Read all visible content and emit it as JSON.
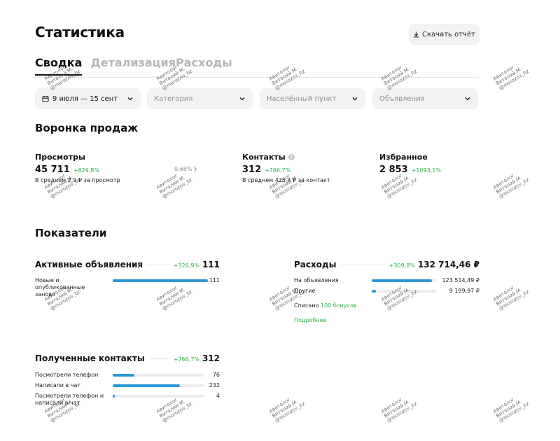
{
  "header": {
    "title": "Статистика",
    "download_label": "Скачать отчёт"
  },
  "tabs": [
    {
      "label": "Сводка",
      "active": true
    },
    {
      "label": "Детализация",
      "active": false
    },
    {
      "label": "Расходы",
      "active": false
    }
  ],
  "filters": {
    "period": "9 июля — 15 сент",
    "category_placeholder": "Категория",
    "city_placeholder": "Населённый пункт",
    "ads_placeholder": "Объявления"
  },
  "funnel": {
    "title": "Воронка продаж",
    "views": {
      "label": "Просмотры",
      "value": "45 711",
      "change": "+629,8%",
      "sub": "В среднем 2,9 ₽ за просмотр"
    },
    "conversion": "0,68%",
    "contacts": {
      "label": "Контакты",
      "value": "312",
      "change": "+766,7%",
      "sub": "В среднем 425,4 ₽ за контакт"
    },
    "favorites": {
      "label": "Избранное",
      "value": "2 853",
      "change": "+1093,1%"
    }
  },
  "indicators": {
    "title": "Показатели",
    "active_ads": {
      "title": "Активные объявления",
      "change": "+326,9%",
      "total": "111",
      "rows": [
        {
          "label": "Новые и опубликованные заново",
          "value": "111",
          "fraction": 1.0
        }
      ]
    },
    "expenses": {
      "title": "Расходы",
      "change": "+309,8%",
      "total": "132 714,46 ₽",
      "rows": [
        {
          "label": "На объявления",
          "value": "123 514,49 ₽",
          "fraction": 0.93
        },
        {
          "label": "Другие",
          "value": "9 199,97 ₽",
          "fraction": 0.07
        }
      ],
      "spent_prefix": "Списано",
      "spent_bonus": "100 бонусов",
      "more_link": "Подробнее"
    },
    "contacts": {
      "title": "Полученные контакты",
      "change": "+766,7%",
      "total": "312",
      "rows": [
        {
          "label": "Посмотрели телефон",
          "value": "76",
          "fraction": 0.24
        },
        {
          "label": "Написали в чат",
          "value": "232",
          "fraction": 0.74
        },
        {
          "label": "Посмотрели телефон и написали в чат",
          "value": "4",
          "fraction": 0.02
        }
      ]
    }
  },
  "watermark": {
    "line1": "Авитолог",
    "line2": "Виталий М.",
    "line3": "@morozov_bz"
  },
  "colors": {
    "accent_green": "#2bb24c",
    "bar_blue": "#2c97d6",
    "control_bg": "#f2f2f2"
  }
}
